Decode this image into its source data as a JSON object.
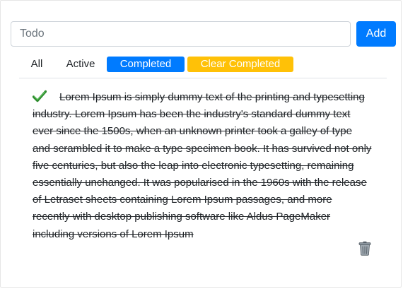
{
  "todo_input": {
    "placeholder": "Todo",
    "value": ""
  },
  "add_button": {
    "label": "Add"
  },
  "filters": {
    "all": "All",
    "active": "Active",
    "completed": "Completed",
    "clear_completed": "Clear Completed",
    "selected": "Completed"
  },
  "todos": [
    {
      "text": "Lorem Ipsum is simply dummy text of the printing and typesetting industry. Lorem Ipsum has been the industry's standard dummy text ever since the 1500s, when an unknown printer took a galley of type and scrambled it to make a type specimen book. It has survived not only five centuries, but also the leap into electronic typesetting, remaining essentially unchanged. It was popularised in the 1960s with the release of Letraset sheets containing Lorem Ipsum passages, and more recently with desktop publishing software like Aldus PageMaker including versions of Lorem Ipsum",
      "completed": true,
      "status_icon": "check-icon",
      "delete_icon": "trash-icon"
    }
  ],
  "colors": {
    "primary": "#007bff",
    "warning": "#ffc107",
    "check": "#2e8b2e"
  }
}
